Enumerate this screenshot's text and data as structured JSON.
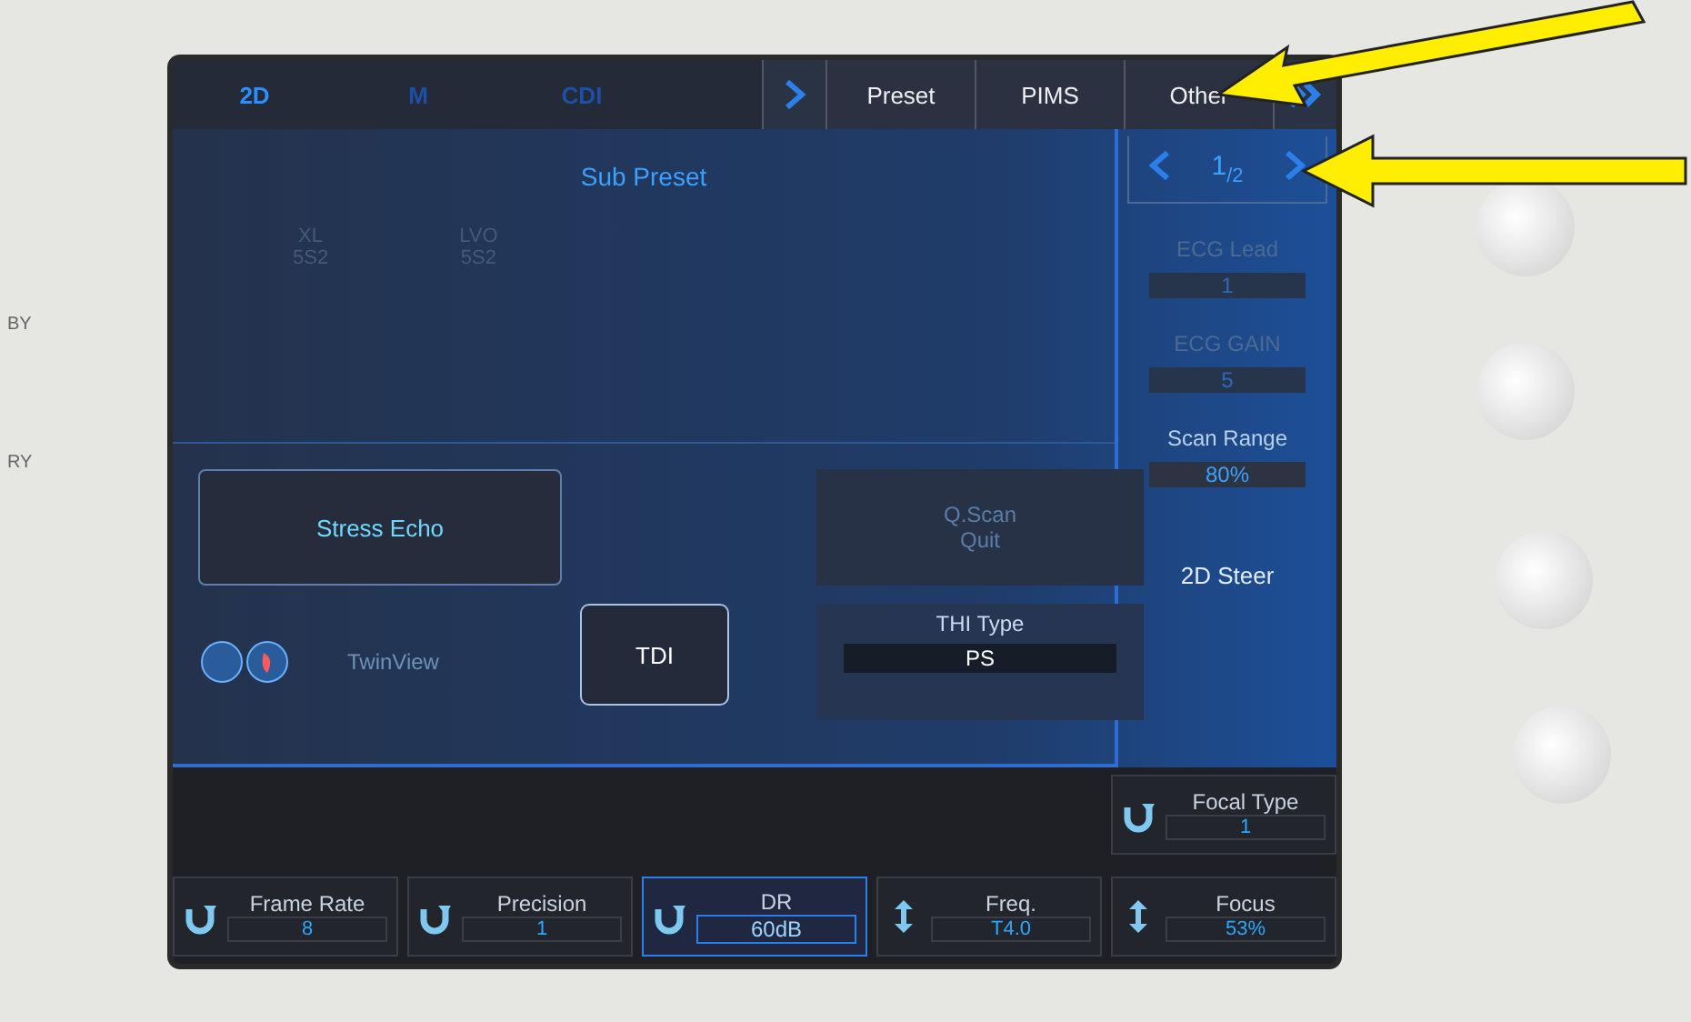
{
  "bezel_labels": [
    "BY",
    "RY"
  ],
  "mode_tabs": [
    {
      "label": "2D",
      "selected": true
    },
    {
      "label": "M",
      "selected": false
    },
    {
      "label": "CDI",
      "selected": false
    }
  ],
  "menu_tabs": [
    "Preset",
    "PIMS",
    "Other"
  ],
  "panel": {
    "title": "Sub Preset",
    "presets": [
      {
        "name": "XL",
        "probe": "5S2"
      },
      {
        "name": "LVO",
        "probe": "5S2"
      }
    ],
    "stress_echo": "Stress Echo",
    "qscan": {
      "lines": [
        "Q.Scan",
        "Quit"
      ],
      "disabled": true
    },
    "twinview": {
      "label": "TwinView",
      "disabled": true
    },
    "tdi": "TDI",
    "thi": {
      "label": "THI Type",
      "value": "PS"
    }
  },
  "pager": {
    "text": "1$_{/2}$"
  },
  "side_controls": [
    {
      "kind": "value",
      "label": "ECG Lead",
      "value": "1",
      "disabled": true
    },
    {
      "kind": "value",
      "label": "ECG GAIN",
      "value": "5",
      "disabled": true
    },
    {
      "kind": "value",
      "label": "Scan Range",
      "value": "80%",
      "disabled": false
    },
    {
      "kind": "label",
      "label": "2D Steer",
      "disabled": false
    }
  ],
  "top_control": {
    "kind": "rotate",
    "label": "Focal Type",
    "value": "1"
  },
  "bottom_controls": [
    {
      "kind": "rotate",
      "label": "Frame Rate",
      "value": "8",
      "selected": false
    },
    {
      "kind": "rotate",
      "label": "Precision",
      "value": "1",
      "selected": false
    },
    {
      "kind": "rotate",
      "label": "DR",
      "value": "60dB",
      "selected": true
    },
    {
      "kind": "updown",
      "label": "Freq.",
      "value": "T4.0",
      "selected": false
    },
    {
      "kind": "updown",
      "label": "Focus",
      "value": "53%",
      "selected": false
    }
  ]
}
